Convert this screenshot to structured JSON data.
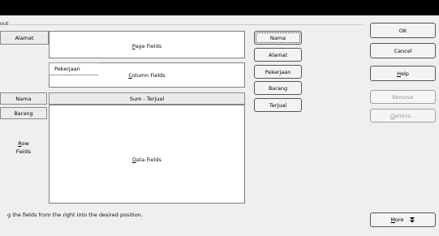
{
  "layout_frame": {
    "label": "out"
  },
  "page_area": {
    "selected_field": "Alamat",
    "label_prefix": "P",
    "label_rest": "age Fields"
  },
  "column_area": {
    "selected_field": "Pekerjaan",
    "label_prefix": "C",
    "label_rest": "olumn Fields"
  },
  "row_area": {
    "fields": [
      "Nama",
      "Barang"
    ],
    "label_prefix": "R",
    "label_rest": "ow",
    "label_line2": "Fields"
  },
  "data_area": {
    "header": "Sum - Terjual",
    "label_prefix": "D",
    "label_rest": "ata Fields"
  },
  "available_fields": [
    "Nama",
    "Alamat",
    "Pekerjaan",
    "Barang",
    "Terjual"
  ],
  "buttons": {
    "ok": "OK",
    "cancel": "Cancel",
    "help_prefix": "H",
    "help_rest": "elp",
    "remove": "Remove",
    "options_prefix": "O",
    "options_rest": "ptions...",
    "more_prefix": "M",
    "more_rest": "ore"
  },
  "footer_text": "g the fields from the right into the desired position."
}
